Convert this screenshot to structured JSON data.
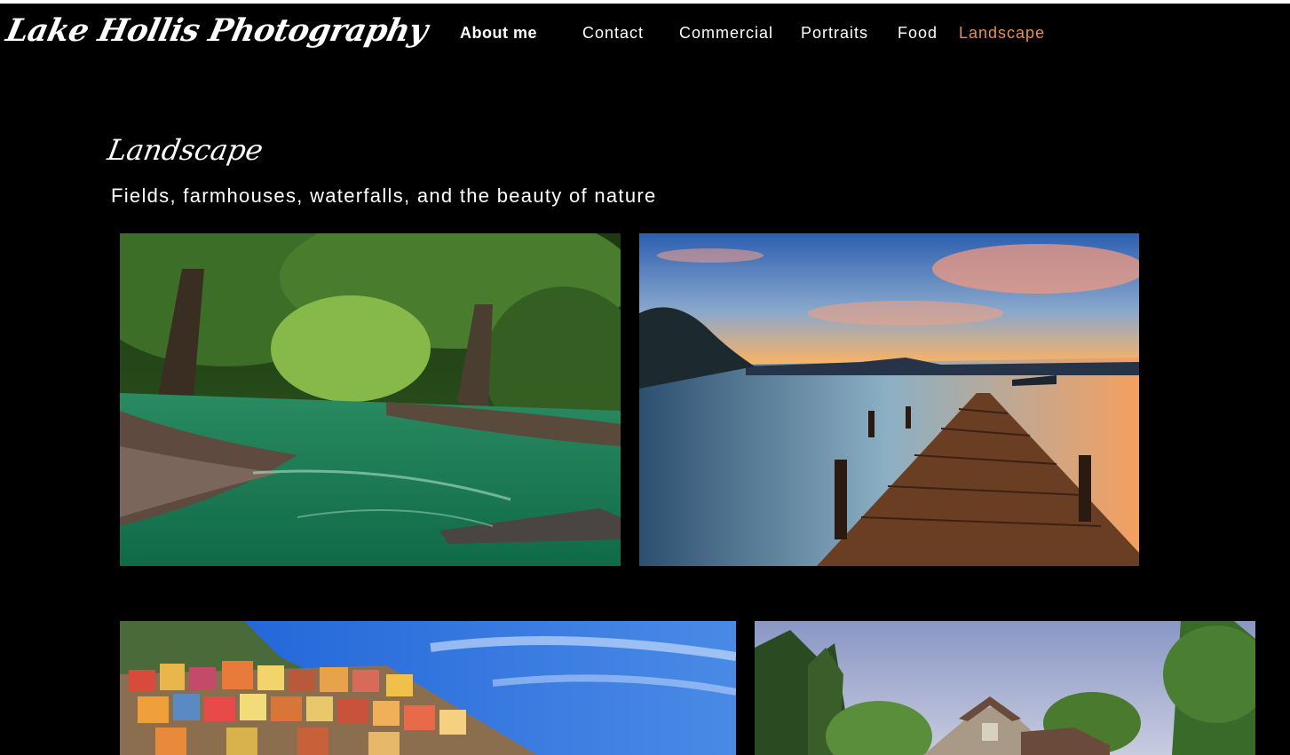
{
  "site": {
    "logo": "Lake Hollis Photography"
  },
  "nav": {
    "about": "About me",
    "contact": "Contact",
    "commercial": "Commercial",
    "portraits": "Portraits",
    "food": "Food",
    "landscape": "Landscape"
  },
  "page": {
    "title": "Landscape",
    "subtitle": "Fields, farmhouses, waterfalls, and the beauty of nature"
  },
  "colors": {
    "background": "#000000",
    "text": "#ffffff",
    "active_nav": "#e8904a"
  }
}
